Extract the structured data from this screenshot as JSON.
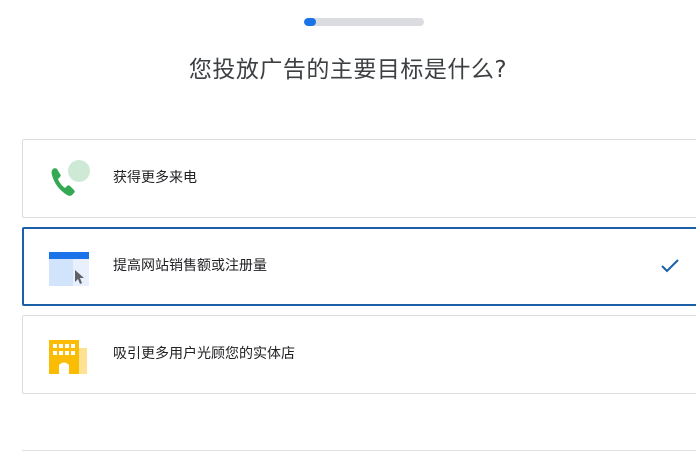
{
  "progress": {
    "fraction": 0.1
  },
  "heading": "您投放广告的主要目标是什么?",
  "options": [
    {
      "label": "获得更多来电",
      "icon": "phone-call-icon",
      "selected": false
    },
    {
      "label": "提高网站销售额或注册量",
      "icon": "website-click-icon",
      "selected": true
    },
    {
      "label": "吸引更多用户光顾您的实体店",
      "icon": "storefront-icon",
      "selected": false
    }
  ],
  "colors": {
    "accent": "#1a73e8",
    "selected_border": "#1a5fa8",
    "check": "#1a5fa8",
    "phone_green": "#34a853",
    "bubble_green": "#ceead6",
    "store_yellow": "#fbbc04"
  }
}
